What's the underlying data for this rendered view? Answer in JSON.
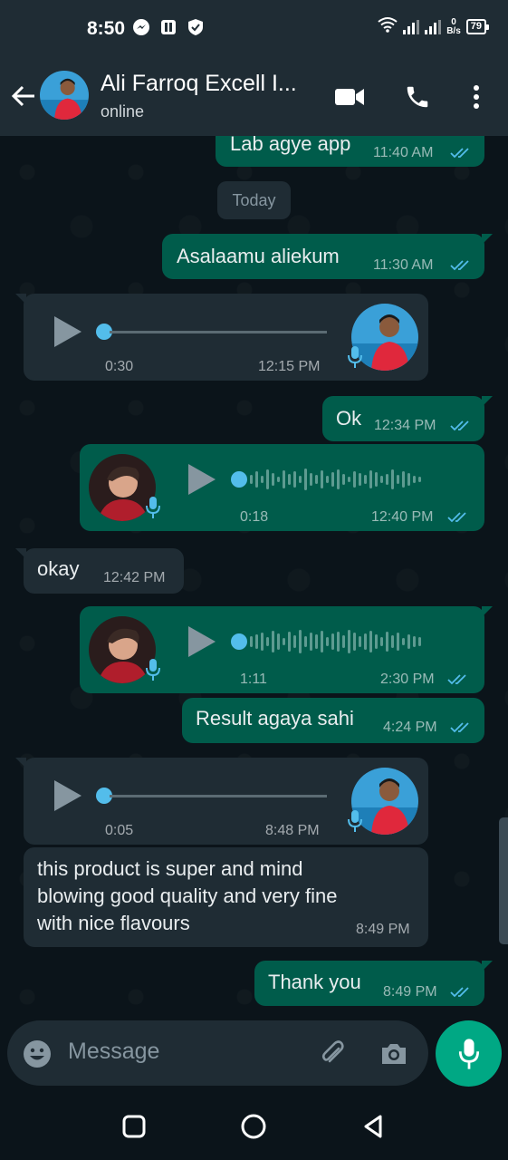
{
  "status_bar": {
    "time": "8:50",
    "net_speed_value": "0",
    "net_speed_unit": "B/s",
    "battery": "79"
  },
  "header": {
    "contact_name": "Ali Farroq Excell I...",
    "status": "online"
  },
  "chat": {
    "date_chip": "Today",
    "messages": [
      {
        "id": "m0",
        "type": "text",
        "direction": "out",
        "text": "Lab agye app",
        "time": "11:40 AM"
      },
      {
        "id": "m1",
        "type": "text",
        "direction": "out",
        "text": "Asalaamu aliekum",
        "time": "11:30 AM"
      },
      {
        "id": "m2",
        "type": "voice",
        "direction": "in",
        "duration": "0:30",
        "time": "12:15 PM"
      },
      {
        "id": "m3",
        "type": "text",
        "direction": "out",
        "text": "Ok",
        "time": "12:34 PM"
      },
      {
        "id": "m4",
        "type": "voice",
        "direction": "out",
        "duration": "0:18",
        "time": "12:40 PM"
      },
      {
        "id": "m5",
        "type": "text",
        "direction": "in",
        "text": "okay",
        "time": "12:42 PM"
      },
      {
        "id": "m6",
        "type": "voice",
        "direction": "out",
        "duration": "1:11",
        "time": "2:30 PM"
      },
      {
        "id": "m7",
        "type": "text",
        "direction": "out",
        "text": "Result agaya sahi",
        "time": "4:24 PM"
      },
      {
        "id": "m8",
        "type": "voice",
        "direction": "in",
        "duration": "0:05",
        "time": "8:48 PM"
      },
      {
        "id": "m9",
        "type": "text",
        "direction": "in",
        "lines": [
          "this product is super and mind",
          "blowing good quality and very fine",
          "with nice flavours"
        ],
        "time": "8:49 PM"
      },
      {
        "id": "m10",
        "type": "text",
        "direction": "out",
        "text": "Thank you",
        "time": "8:49 PM"
      }
    ]
  },
  "composer": {
    "placeholder": "Message"
  },
  "icons": {
    "back": "arrow-left-icon",
    "video": "video-camera-icon",
    "call": "phone-icon",
    "menu": "more-vertical-icon",
    "emoji": "emoji-icon",
    "attach": "paperclip-icon",
    "camera": "camera-icon",
    "mic": "microphone-icon",
    "read": "double-check-icon",
    "play": "play-icon"
  },
  "colors": {
    "outgoing": "#005c4b",
    "incoming": "#1f2c34",
    "accent": "#00a884",
    "read_ticks": "#53bdeb",
    "background": "#0b141a"
  }
}
